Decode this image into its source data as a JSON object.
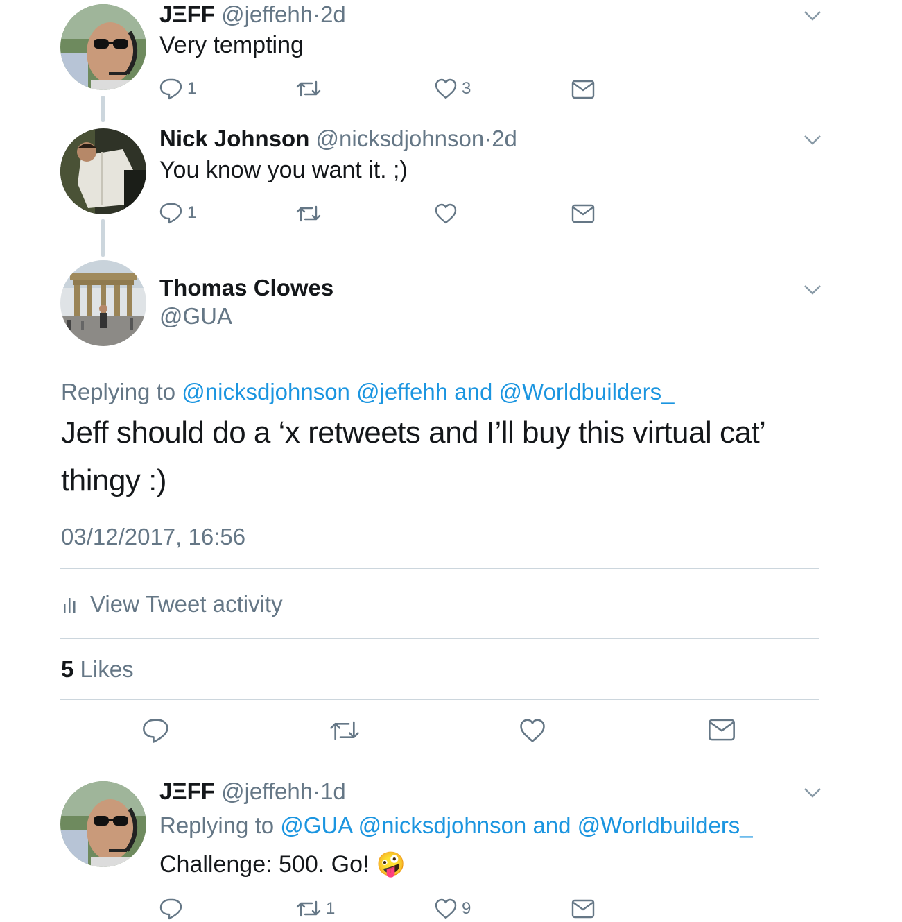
{
  "tweets": [
    {
      "display_name": "JΞFF",
      "handle": "@jeffehh",
      "age": "2d",
      "text": "Very tempting",
      "replies": "1",
      "retweets": "",
      "likes": "3"
    },
    {
      "display_name": "Nick Johnson",
      "handle": "@nicksdjohnson",
      "age": "2d",
      "text": "You know you want it. ;)",
      "replies": "1",
      "retweets": "",
      "likes": ""
    }
  ],
  "main_tweet": {
    "display_name": "Thomas Clowes",
    "handle": "@GUA",
    "replying_prefix": "Replying to",
    "reply_handles": "@nicksdjohnson @jeffehh and @Worldbuilders_",
    "text_line1": "Jeff should do a ‘x retweets and I’ll buy this virtual cat’",
    "text_line2": "thingy :)",
    "timestamp": "03/12/2017, 16:56",
    "activity_label": "View Tweet activity",
    "likes_count": "5",
    "likes_label": "Likes"
  },
  "reply_tweet": {
    "display_name": "JΞFF",
    "handle": "@jeffehh",
    "age": "1d",
    "replying_prefix": "Replying to",
    "reply_handles": "@GUA @nicksdjohnson and @Worldbuilders_",
    "text": "Challenge: 500. Go!",
    "emoji": "🤪",
    "replies": "",
    "retweets": "1",
    "likes": "9"
  },
  "separator": "·",
  "colors": {
    "link": "#1b95e0",
    "muted": "#657786",
    "divider": "#ccd6dd",
    "text": "#14171a"
  },
  "icons": [
    "reply-icon",
    "retweet-icon",
    "like-icon",
    "direct-message-icon",
    "chevron-down-icon",
    "activity-bars-icon"
  ]
}
